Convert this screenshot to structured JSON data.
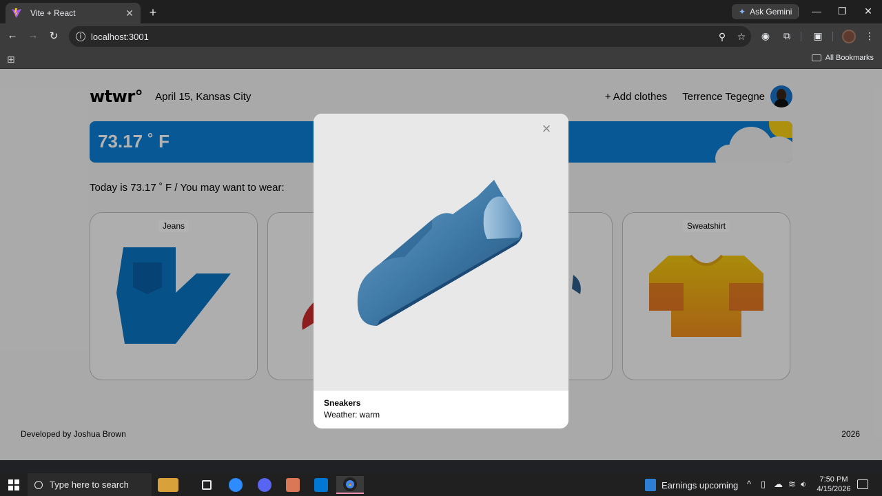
{
  "browser": {
    "tab_title": "Vite + React",
    "tab_close": "✕",
    "new_tab": "+",
    "ask_gemini": "Ask Gemini",
    "url": "localhost:3001",
    "all_bookmarks": "All Bookmarks",
    "window_controls": [
      "—",
      "❐",
      "✕"
    ]
  },
  "app": {
    "logo": "wtwr°",
    "date_location": "April 15, Kansas City",
    "add_clothes": "+ Add clothes",
    "username": "Terrence Tegegne",
    "temperature": "73.17 ˚ F",
    "today_text": "Today is 73.17 ˚ F / You may want to wear:",
    "cards": [
      {
        "label": "Jeans"
      },
      {
        "label": "Sweatshirt"
      }
    ],
    "footer_left": "Developed by Joshua Brown",
    "footer_right": "2026"
  },
  "modal": {
    "close": "×",
    "item_name": "Sneakers",
    "weather": "Weather: warm"
  },
  "taskbar": {
    "search_placeholder": "Type here to search",
    "news": "Earnings upcoming",
    "time": "7:50 PM",
    "date": "4/15/2026"
  },
  "colors": {
    "weather_bar": "#0b7ed6",
    "sun": "#f8cf15"
  }
}
